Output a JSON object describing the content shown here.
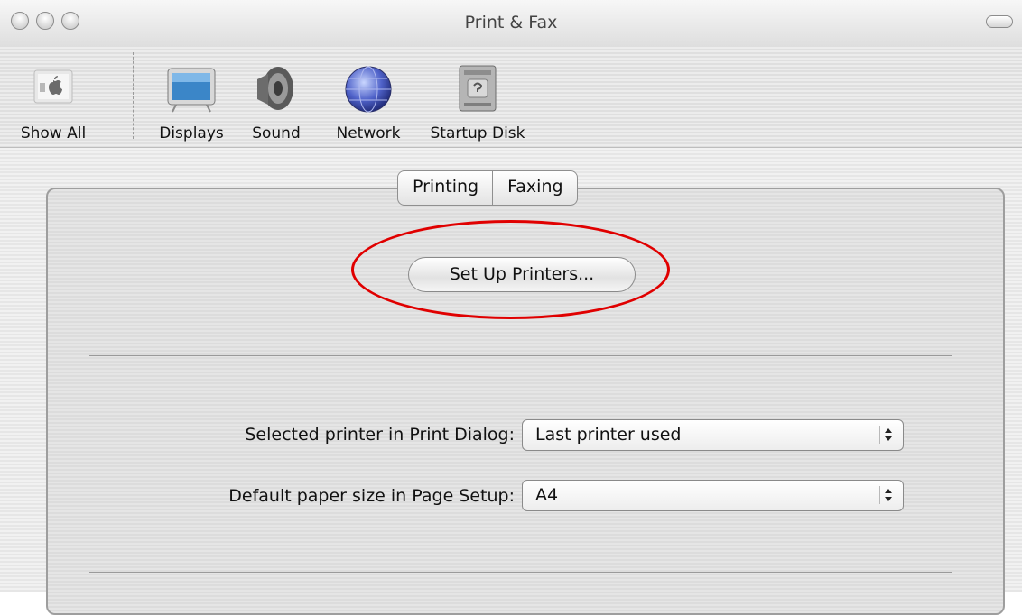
{
  "window": {
    "title": "Print & Fax"
  },
  "toolbar": {
    "items": [
      {
        "label": "Show All",
        "icon": "apple-icon"
      },
      {
        "label": "Displays",
        "icon": "display-icon"
      },
      {
        "label": "Sound",
        "icon": "speaker-icon"
      },
      {
        "label": "Network",
        "icon": "globe-icon"
      },
      {
        "label": "Startup Disk",
        "icon": "disk-icon"
      }
    ]
  },
  "tabs": [
    {
      "label": "Printing",
      "selected": true
    },
    {
      "label": "Faxing",
      "selected": false
    }
  ],
  "printing": {
    "setup_button_label": "Set Up Printers...",
    "selected_printer_label": "Selected printer in Print Dialog:",
    "selected_printer_value": "Last printer used",
    "paper_size_label": "Default paper size in Page Setup:",
    "paper_size_value": "A4"
  },
  "annotation_color": "#e00000"
}
